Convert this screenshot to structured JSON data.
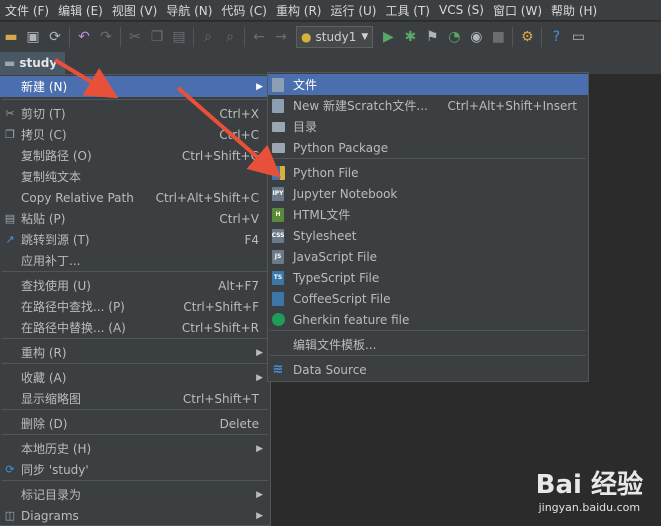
{
  "menubar": [
    "文件 (F)",
    "编辑 (E)",
    "视图 (V)",
    "导航 (N)",
    "代码 (C)",
    "重构 (R)",
    "运行 (U)",
    "工具 (T)",
    "VCS (S)",
    "窗口 (W)",
    "帮助 (H)"
  ],
  "toolbar": {
    "run_config": "study1"
  },
  "navbar": {
    "project": "study"
  },
  "context_menu": [
    {
      "label": "新建 (N)",
      "shortcut": "",
      "submenu": true,
      "highlight": true,
      "icon": ""
    },
    {
      "label": "剪切 (T)",
      "shortcut": "Ctrl+X",
      "icon": "scissors-icon"
    },
    {
      "label": "拷贝 (C)",
      "shortcut": "Ctrl+C",
      "icon": "copy-icon"
    },
    {
      "label": "复制路径 (O)",
      "shortcut": "Ctrl+Shift+C",
      "icon": ""
    },
    {
      "label": "复制纯文本",
      "shortcut": "",
      "icon": ""
    },
    {
      "label": "Copy Relative Path",
      "shortcut": "Ctrl+Alt+Shift+C",
      "icon": ""
    },
    {
      "label": "粘贴 (P)",
      "shortcut": "Ctrl+V",
      "icon": "paste-icon"
    },
    {
      "label": "跳转到源 (T)",
      "shortcut": "F4",
      "icon": "jump-to-source-icon"
    },
    {
      "label": "应用补丁...",
      "shortcut": "",
      "icon": ""
    },
    {
      "label": "查找使用 (U)",
      "shortcut": "Alt+F7",
      "icon": ""
    },
    {
      "label": "在路径中查找... (P)",
      "shortcut": "Ctrl+Shift+F",
      "icon": ""
    },
    {
      "label": "在路径中替换... (A)",
      "shortcut": "Ctrl+Shift+R",
      "icon": ""
    },
    {
      "label": "重构 (R)",
      "shortcut": "",
      "submenu": true,
      "icon": ""
    },
    {
      "label": "收藏 (A)",
      "shortcut": "",
      "submenu": true,
      "icon": ""
    },
    {
      "label": "显示缩略图",
      "shortcut": "Ctrl+Shift+T",
      "icon": ""
    },
    {
      "label": "删除 (D)",
      "shortcut": "Delete",
      "icon": ""
    },
    {
      "label": "本地历史 (H)",
      "shortcut": "",
      "submenu": true,
      "icon": ""
    },
    {
      "label": "同步 'study'",
      "shortcut": "",
      "icon": "sync-icon"
    },
    {
      "label": "标记目录为",
      "shortcut": "",
      "submenu": true,
      "icon": ""
    },
    {
      "label": "Diagrams",
      "shortcut": "",
      "submenu": true,
      "icon": "diagrams-icon"
    }
  ],
  "submenu": [
    {
      "label": "文件",
      "shortcut": "",
      "highlight": true,
      "icon": "file-icon",
      "badge": "",
      "color": "#8da0b3"
    },
    {
      "label": "New 新建Scratch文件...",
      "shortcut": "Ctrl+Alt+Shift+Insert",
      "icon": "scratch-file-icon",
      "badge": "",
      "color": "#8da0b3"
    },
    {
      "label": "目录",
      "shortcut": "",
      "icon": "folder-icon",
      "badge": "",
      "color": "#9aa7b0"
    },
    {
      "label": "Python Package",
      "shortcut": "",
      "icon": "python-package-icon",
      "badge": "",
      "color": "#9aa7b0"
    },
    {
      "label": "Python File",
      "shortcut": "",
      "icon": "python-file-icon",
      "badge": "",
      "color": "#3b77a8"
    },
    {
      "label": "Jupyter Notebook",
      "shortcut": "",
      "icon": "jupyter-icon",
      "badge": "IPYNB",
      "color": "#6b7a88"
    },
    {
      "label": "HTML文件",
      "shortcut": "",
      "icon": "html-file-icon",
      "badge": "H",
      "color": "#5a8a3a"
    },
    {
      "label": "Stylesheet",
      "shortcut": "",
      "icon": "css-file-icon",
      "badge": "CSS",
      "color": "#6b7a88"
    },
    {
      "label": "JavaScript File",
      "shortcut": "",
      "icon": "js-file-icon",
      "badge": "JS",
      "color": "#6b7a88"
    },
    {
      "label": "TypeScript File",
      "shortcut": "",
      "icon": "ts-file-icon",
      "badge": "TS",
      "color": "#3b77a8"
    },
    {
      "label": "CoffeeScript File",
      "shortcut": "",
      "icon": "coffeescript-icon",
      "badge": "",
      "color": "#3b77a8"
    },
    {
      "label": "Gherkin feature file",
      "shortcut": "",
      "icon": "gherkin-icon",
      "badge": "",
      "color": "#1d9e58"
    },
    {
      "label": "编辑文件模板...",
      "shortcut": "",
      "icon": "",
      "badge": "",
      "color": ""
    },
    {
      "label": "Data Source",
      "shortcut": "",
      "icon": "data-source-icon",
      "badge": "",
      "color": "#4a8fd8"
    }
  ],
  "watermark": {
    "brand": "Bai 经验",
    "url": "jingyan.baidu.com"
  },
  "colors": {
    "arrow": "#e8503a",
    "highlight": "#4b6eaf",
    "menu_bg": "#3c3f41"
  }
}
